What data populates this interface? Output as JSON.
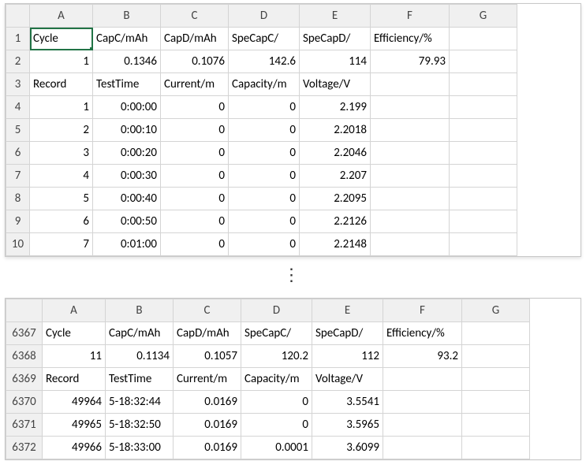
{
  "columns": [
    "A",
    "B",
    "C",
    "D",
    "E",
    "F",
    "G"
  ],
  "top": {
    "rows": [
      "1",
      "2",
      "3",
      "4",
      "5",
      "6",
      "7",
      "8",
      "9",
      "10"
    ],
    "cells": {
      "r1": {
        "A": "Cycle",
        "B": "CapC/mAh",
        "C": "CapD/mAh",
        "D": "SpeCapC/",
        "E": "SpeCapD/",
        "F": "Efficiency/%",
        "G": ""
      },
      "r2": {
        "A": "1",
        "B": "0.1346",
        "C": "0.1076",
        "D": "142.6",
        "E": "114",
        "F": "79.93",
        "G": ""
      },
      "r3": {
        "A": "Record",
        "B": "TestTime",
        "C": "Current/m",
        "D": "Capacity/m",
        "E": "Voltage/V",
        "F": "",
        "G": ""
      },
      "r4": {
        "A": "1",
        "B": "0:00:00",
        "C": "0",
        "D": "0",
        "E": "2.199",
        "F": "",
        "G": ""
      },
      "r5": {
        "A": "2",
        "B": "0:00:10",
        "C": "0",
        "D": "0",
        "E": "2.2018",
        "F": "",
        "G": ""
      },
      "r6": {
        "A": "3",
        "B": "0:00:20",
        "C": "0",
        "D": "0",
        "E": "2.2046",
        "F": "",
        "G": ""
      },
      "r7": {
        "A": "4",
        "B": "0:00:30",
        "C": "0",
        "D": "0",
        "E": "2.207",
        "F": "",
        "G": ""
      },
      "r8": {
        "A": "5",
        "B": "0:00:40",
        "C": "0",
        "D": "0",
        "E": "2.2095",
        "F": "",
        "G": ""
      },
      "r9": {
        "A": "6",
        "B": "0:00:50",
        "C": "0",
        "D": "0",
        "E": "2.2126",
        "F": "",
        "G": ""
      },
      "r10": {
        "A": "7",
        "B": "0:01:00",
        "C": "0",
        "D": "0",
        "E": "2.2148",
        "F": "",
        "G": ""
      }
    }
  },
  "ellipsis": "⋮",
  "bottom": {
    "rows": [
      "6367",
      "6368",
      "6369",
      "6370",
      "6371",
      "6372"
    ],
    "cells": {
      "r6367": {
        "A": "Cycle",
        "B": "CapC/mAh",
        "C": "CapD/mAh",
        "D": "SpeCapC/",
        "E": "SpeCapD/",
        "F": "Efficiency/%",
        "G": ""
      },
      "r6368": {
        "A": "11",
        "B": "0.1134",
        "C": "0.1057",
        "D": "120.2",
        "E": "112",
        "F": "93.2",
        "G": ""
      },
      "r6369": {
        "A": "Record",
        "B": "TestTime",
        "C": "Current/m",
        "D": "Capacity/m",
        "E": "Voltage/V",
        "F": "",
        "G": ""
      },
      "r6370": {
        "A": "49964",
        "B": "5-18:32:44",
        "C": "0.0169",
        "D": "0",
        "E": "3.5541",
        "F": "",
        "G": ""
      },
      "r6371": {
        "A": "49965",
        "B": "5-18:32:50",
        "C": "0.0169",
        "D": "0",
        "E": "3.5965",
        "F": "",
        "G": ""
      },
      "r6372": {
        "A": "49966",
        "B": "5-18:33:00",
        "C": "0.0169",
        "D": "0.0001",
        "E": "3.6099",
        "F": "",
        "G": ""
      }
    }
  },
  "selected_cell": "A1",
  "text_cells": [
    "top.r1.A",
    "top.r1.B",
    "top.r1.C",
    "top.r1.D",
    "top.r1.E",
    "top.r1.F",
    "top.r3.A",
    "top.r3.B",
    "top.r3.C",
    "top.r3.D",
    "top.r3.E",
    "bottom.r6367.A",
    "bottom.r6367.B",
    "bottom.r6367.C",
    "bottom.r6367.D",
    "bottom.r6367.E",
    "bottom.r6367.F",
    "bottom.r6369.A",
    "bottom.r6369.B",
    "bottom.r6369.C",
    "bottom.r6369.D",
    "bottom.r6369.E"
  ]
}
